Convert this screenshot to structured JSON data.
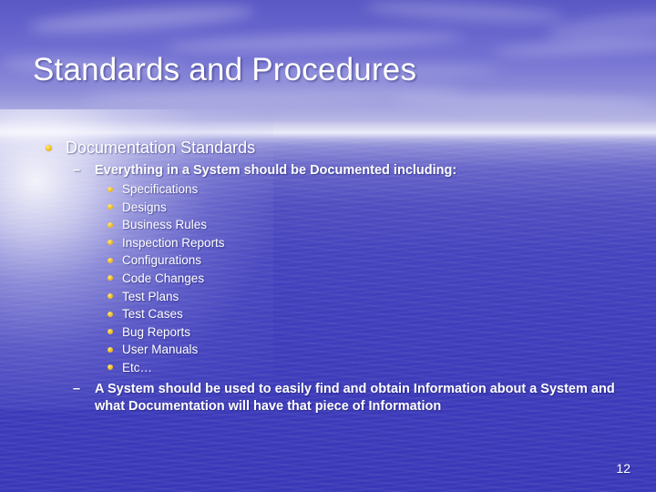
{
  "slide": {
    "title": "Standards and Procedures",
    "page_number": "12",
    "colors": {
      "title_text": "#ffffff",
      "body_text": "#ffffff",
      "bullet_gold": "#f3c42a",
      "water_blue": "#3f3dbb",
      "sky_blue": "#6462cb"
    },
    "level1": {
      "bullet_icon": "gold-dot-icon",
      "text": "Documentation Standards"
    },
    "level2_first": {
      "bullet_icon": "dash-icon",
      "marker": "–",
      "text": "Everything in a System should be Documented including:"
    },
    "level3_items": [
      {
        "bullet_icon": "gold-dot-icon",
        "text": "Specifications"
      },
      {
        "bullet_icon": "gold-dot-icon",
        "text": "Designs"
      },
      {
        "bullet_icon": "gold-dot-icon",
        "text": "Business Rules"
      },
      {
        "bullet_icon": "gold-dot-icon",
        "text": "Inspection Reports"
      },
      {
        "bullet_icon": "gold-dot-icon",
        "text": "Configurations"
      },
      {
        "bullet_icon": "gold-dot-icon",
        "text": "Code Changes"
      },
      {
        "bullet_icon": "gold-dot-icon",
        "text": "Test Plans"
      },
      {
        "bullet_icon": "gold-dot-icon",
        "text": "Test Cases"
      },
      {
        "bullet_icon": "gold-dot-icon",
        "text": "Bug Reports"
      },
      {
        "bullet_icon": "gold-dot-icon",
        "text": "User Manuals"
      },
      {
        "bullet_icon": "gold-dot-icon",
        "text": "Etc…"
      }
    ],
    "level2_last": {
      "bullet_icon": "dash-icon",
      "marker": "–",
      "text": "A System should be used to easily find and obtain Information about a System and what Documentation will have that piece of Information"
    }
  }
}
